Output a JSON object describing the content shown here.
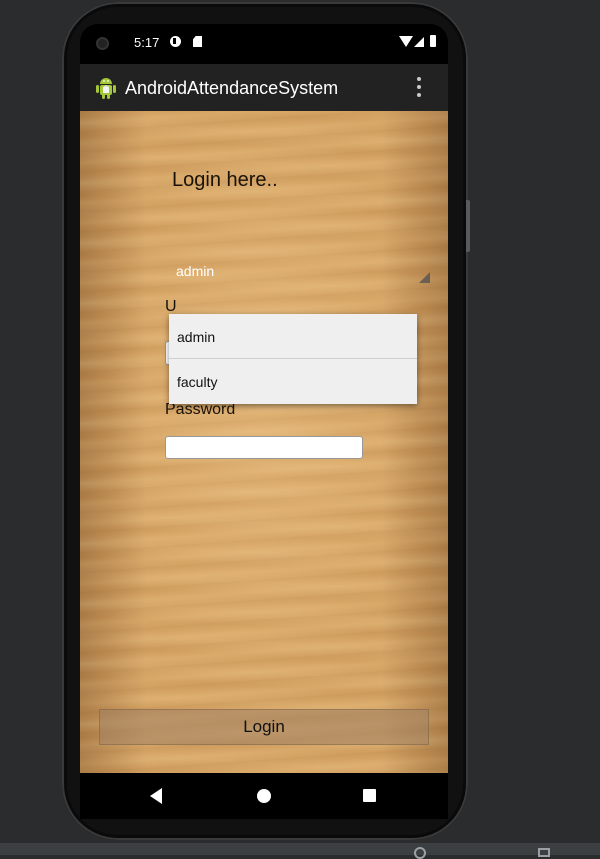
{
  "status_bar": {
    "time": "5:17",
    "icons": [
      "camera-icon",
      "notification-icon",
      "sd-card-icon",
      "wifi-icon",
      "signal-icon",
      "battery-icon"
    ]
  },
  "app_bar": {
    "title": "AndroidAttendanceSystem",
    "app_icon": "android-robot-icon",
    "menu_icon": "overflow-menu-icon"
  },
  "login": {
    "heading": "Login here..",
    "role_spinner": {
      "selected": "admin"
    },
    "username_label": "U",
    "password_label": "Password",
    "button_label": "Login"
  },
  "dropdown": {
    "options": [
      "admin",
      "faculty"
    ]
  },
  "nav_bar": {
    "icons": [
      "back-icon",
      "home-icon",
      "recents-icon"
    ]
  },
  "colors": {
    "app_bar": "#222222",
    "wood": "#d9a868",
    "dropdown_bg": "#efefef",
    "ide_bg": "#2b2c2e"
  }
}
